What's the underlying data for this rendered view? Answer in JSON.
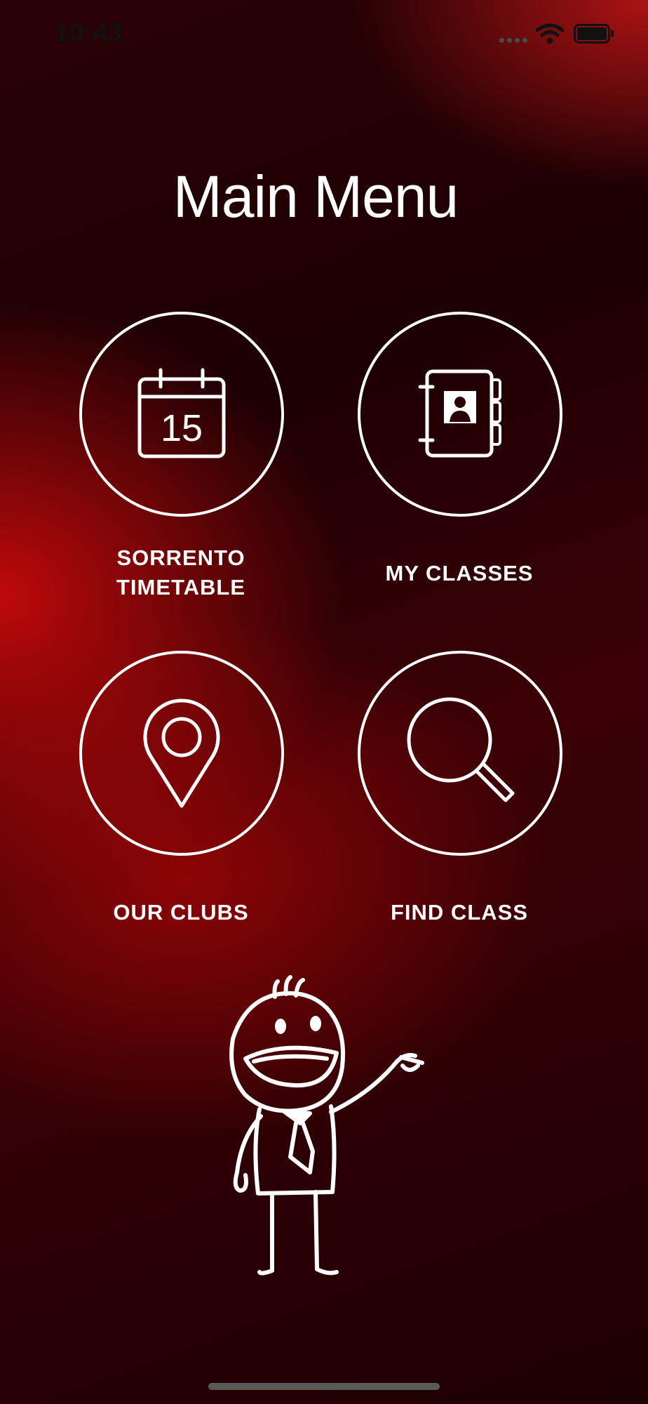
{
  "status_bar": {
    "time": "10:43"
  },
  "screen": {
    "title": "Main Menu"
  },
  "menu": {
    "items": [
      {
        "label": "SORRENTO\nTIMETABLE",
        "icon": "calendar-icon",
        "calendar_day": "15"
      },
      {
        "label": "MY CLASSES",
        "icon": "contact-book-icon"
      },
      {
        "label": "OUR CLUBS",
        "icon": "location-pin-icon"
      },
      {
        "label": "FIND CLASS",
        "icon": "magnifier-icon"
      }
    ]
  },
  "mascot": {
    "icon": "stick-figure-mascot"
  },
  "colors": {
    "background_dark": "#1c0002",
    "background_red": "#c80a0a",
    "foreground": "#ffffff"
  }
}
